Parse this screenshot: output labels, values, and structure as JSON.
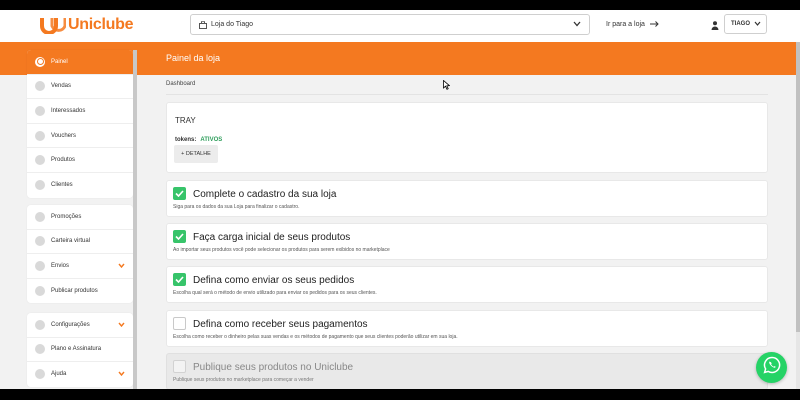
{
  "brand": {
    "name": "Uniclube",
    "accent": "#f47920"
  },
  "header": {
    "store_select": {
      "value": "Loja do Tiago",
      "icon": "shopping-bag-icon"
    },
    "goto_store": "Ir para a loja",
    "user": {
      "name": "TIAGO",
      "icon": "user-icon"
    }
  },
  "page": {
    "title": "Painel da loja",
    "breadcrumb": "Dashboard"
  },
  "sidebar": {
    "group1": [
      {
        "label": "Painel",
        "active": true
      },
      {
        "label": "Vendas"
      },
      {
        "label": "Interessados"
      },
      {
        "label": "Vouchers"
      },
      {
        "label": "Produtos"
      },
      {
        "label": "Clientes"
      }
    ],
    "group2": [
      {
        "label": "Promoções"
      },
      {
        "label": "Carteira virtual"
      },
      {
        "label": "Envios",
        "expandable": true
      },
      {
        "label": "Publicar produtos"
      }
    ],
    "group3": [
      {
        "label": "Configurações",
        "expandable": true
      },
      {
        "label": "Plano e Assinatura"
      },
      {
        "label": "Ajuda",
        "expandable": true
      }
    ]
  },
  "tray": {
    "title": "TRAY",
    "tokens_label": "tokens:",
    "tokens_status": "ATIVOS",
    "detail_button": "+ DETALHE"
  },
  "steps": [
    {
      "title": "Complete o cadastro da sua loja",
      "desc": "Siga para os dados da sua Loja para finalizar o cadastro.",
      "checked": true
    },
    {
      "title": "Faça carga inicial de seus produtos",
      "desc": "Ao importar seus produtos você pode selecionar os produtos para serem exibidos no marketplace",
      "checked": true
    },
    {
      "title": "Defina como enviar os seus pedidos",
      "desc": "Escolha qual será o método de envio utilizado para enviar os pedidos para os seus clientes.",
      "checked": true
    },
    {
      "title": "Defina como receber seus pagamentos",
      "desc": "Escolha como receber o dinheiro pelas suas vendas e os métodos de pagamento que seus clientes poderão utilizar em sua loja.",
      "checked": false
    },
    {
      "title": "Publique seus produtos no Uniclube",
      "desc": "Publique seus produtos no marketplace para começar a vender",
      "checked": false,
      "disabled": true
    }
  ],
  "whatsapp": {
    "icon": "whatsapp-icon",
    "color": "#25d366"
  }
}
